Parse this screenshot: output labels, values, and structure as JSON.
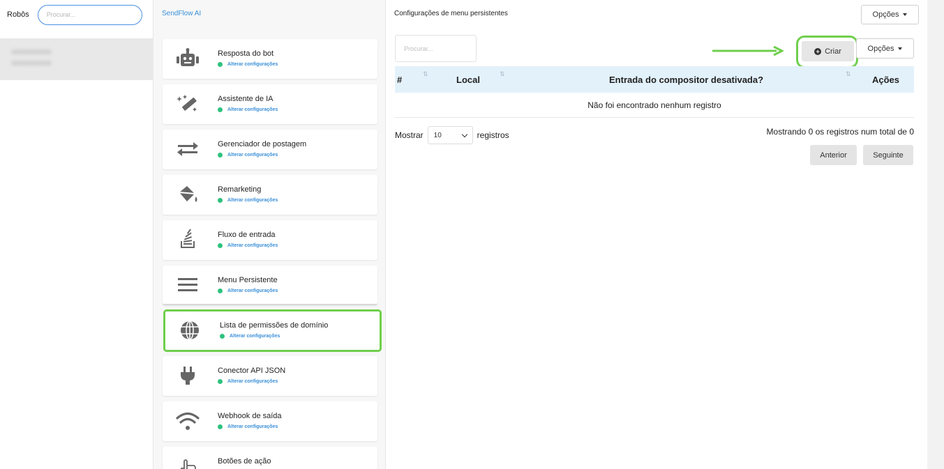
{
  "bots": {
    "title": "Robôs",
    "search_placeholder": "Procurar..."
  },
  "menu": {
    "brand": "SendFlow AI",
    "items": [
      {
        "title": "Resposta do bot",
        "status": "Alterar configurações",
        "icon": "robot-icon"
      },
      {
        "title": "Assistente de IA",
        "status": "Alterar configurações",
        "icon": "magic-wand-icon"
      },
      {
        "title": "Gerenciador de postagem",
        "status": "Alterar configurações",
        "icon": "exchange-arrows-icon"
      },
      {
        "title": "Remarketing",
        "status": "Alterar configurações",
        "icon": "paint-bucket-icon"
      },
      {
        "title": "Fluxo de entrada",
        "status": "Alterar configurações",
        "icon": "inbox-stack-icon"
      },
      {
        "title": "Menu Persistente",
        "status": "Alterar configurações",
        "icon": "menu-bars-icon"
      },
      {
        "title": "Lista de permissões de domínio",
        "status": "Alterar configurações",
        "icon": "globe-icon"
      },
      {
        "title": "Conector API JSON",
        "status": "Alterar configurações",
        "icon": "plug-icon"
      },
      {
        "title": "Webhook de saída",
        "status": "Alterar configurações",
        "icon": "wifi-icon"
      },
      {
        "title": "Botões de ação",
        "status": "",
        "icon": "hand-pointer-icon"
      }
    ]
  },
  "main": {
    "title": "Configurações de menu persistentes",
    "options_label": "Opções",
    "search_placeholder": "Procurar...",
    "create_label": "Criar",
    "options2_label": "Opções",
    "table": {
      "headers": [
        "#",
        "Local",
        "Entrada do compositor desativada?",
        "Ações"
      ],
      "empty": "Não foi encontrado nenhum registro"
    },
    "show_label": "Mostrar",
    "page_length": "10",
    "records_label": "registros",
    "info": "Mostrando 0 os registros num total de 0",
    "prev_label": "Anterior",
    "next_label": "Seguinte"
  },
  "colors": {
    "accent_blue": "#3a8fd8",
    "status_green": "#2ec27e",
    "highlight_green": "#6fcf4d",
    "table_header_bg": "#e3f1fb"
  }
}
